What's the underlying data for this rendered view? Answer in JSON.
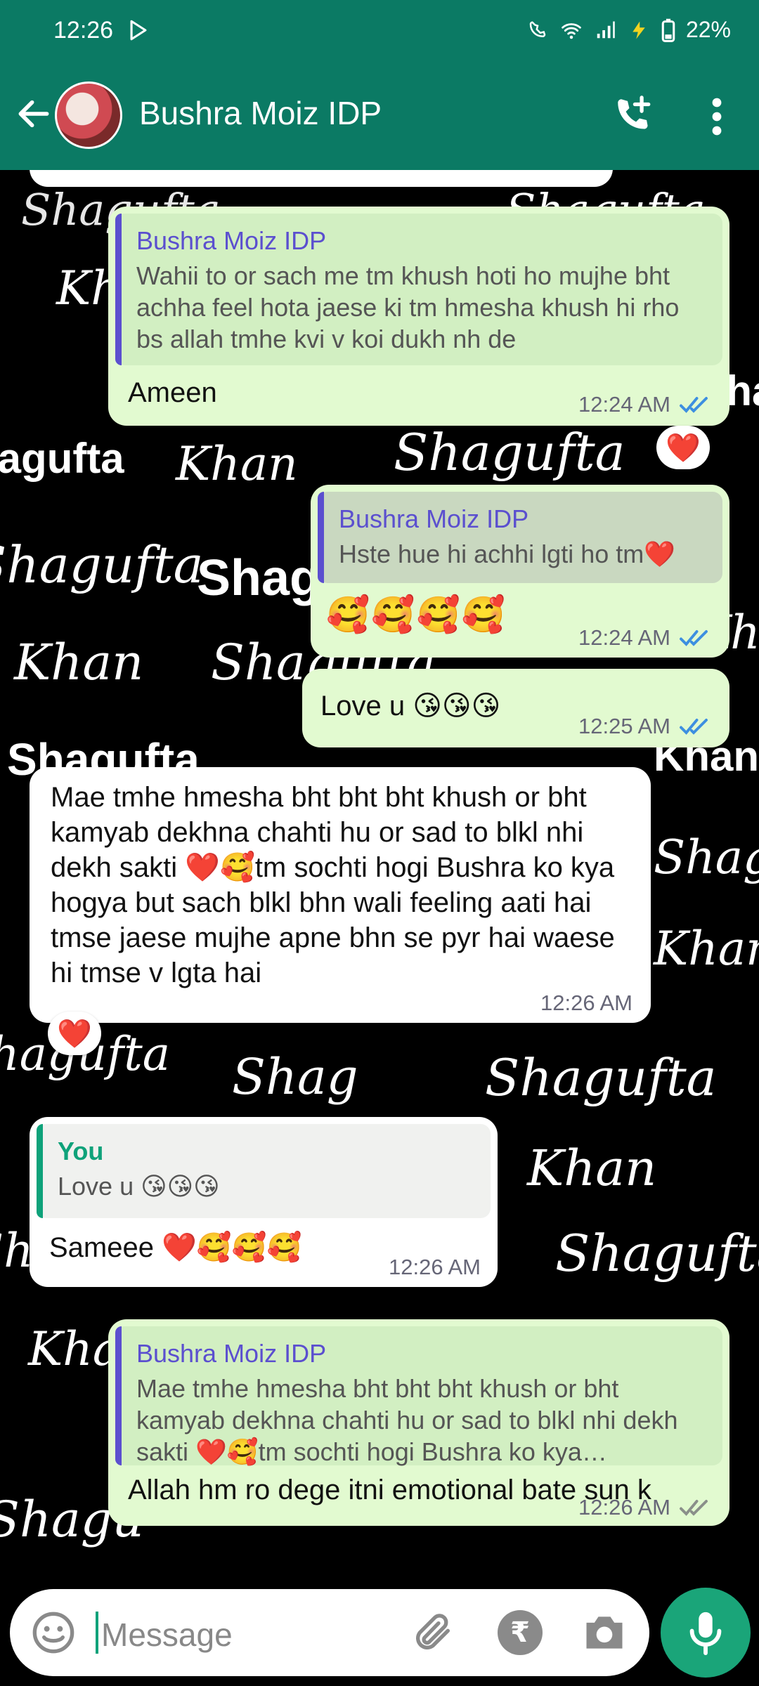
{
  "status": {
    "time": "12:26",
    "battery": "22%"
  },
  "header": {
    "contact_name": "Bushra Moiz IDP"
  },
  "watermark": {
    "words": [
      "Shagufta",
      "Khan",
      "Shagufta",
      "Khan",
      "Shagufta",
      "Shagufta",
      "Khan",
      "Shagufta",
      "Khan",
      "Shagufta",
      "Shagufta",
      "Khan",
      "Shagufta",
      "Khan",
      "Shagufta",
      "Khan",
      "Shagufta",
      "Shag",
      "Shagufta",
      "Shagufta",
      "Khan",
      "Shagufta",
      "Khan",
      "Shagu",
      "Shagufta",
      "Khan",
      "Khan",
      "Shagufta",
      "Khan",
      "Shagufta",
      "Khan",
      "Shagufta"
    ]
  },
  "messages": {
    "m1": {
      "quote_name": "Bushra Moiz IDP",
      "quote_text": "Wahii to or sach me tm khush hoti ho mujhe bht achha feel hota jaese ki tm hmesha khush hi rho bs allah tmhe kvi v koi dukh nh de",
      "text": "Ameen",
      "time": "12:24 AM",
      "reaction": "❤️"
    },
    "m2": {
      "quote_name": "Bushra Moiz IDP",
      "quote_text": "Hste hue hi achhi lgti ho tm❤️",
      "text": "🥰🥰🥰🥰",
      "time": "12:24 AM"
    },
    "m3": {
      "text": "Love u 😘😘😘",
      "time": "12:25 AM"
    },
    "m4": {
      "text": "Mae tmhe hmesha bht bht bht khush or bht kamyab dekhna chahti hu or sad to blkl nhi dekh sakti ❤️🥰tm sochti hogi Bushra ko kya hogya but sach blkl bhn wali feeling aati hai tmse jaese mujhe apne bhn se pyr hai waese hi tmse v lgta hai",
      "time": "12:26 AM",
      "reaction": "❤️"
    },
    "m5": {
      "quote_name": "You",
      "quote_text": "Love u 😘😘😘",
      "text": "Sameee ❤️🥰🥰🥰",
      "time": "12:26 AM"
    },
    "m6": {
      "quote_name": "Bushra Moiz IDP",
      "quote_text": "Mae tmhe hmesha bht bht bht khush or bht kamyab dekhna chahti hu or sad to blkl nhi dekh sakti ❤️🥰tm sochti hogi Bushra ko kya…",
      "text": "Allah hm ro dege itni emotional bate sun k",
      "time": "12:26 AM"
    }
  },
  "input": {
    "placeholder": "Message"
  },
  "colors": {
    "header": "#0b7a64",
    "outgoing_bubble": "#e2fad0",
    "incoming_bubble": "#ffffff",
    "accent": "#1aa579",
    "quote_bar_purple": "#5b4fcf",
    "quote_bar_green": "#0ea27a",
    "read_tick": "#3d8fe0"
  },
  "icons": [
    "back-arrow-icon",
    "add-call-icon",
    "more-vert-icon",
    "smiley-icon",
    "attach-icon",
    "rupee-icon",
    "camera-icon",
    "mic-icon",
    "double-tick-icon"
  ]
}
